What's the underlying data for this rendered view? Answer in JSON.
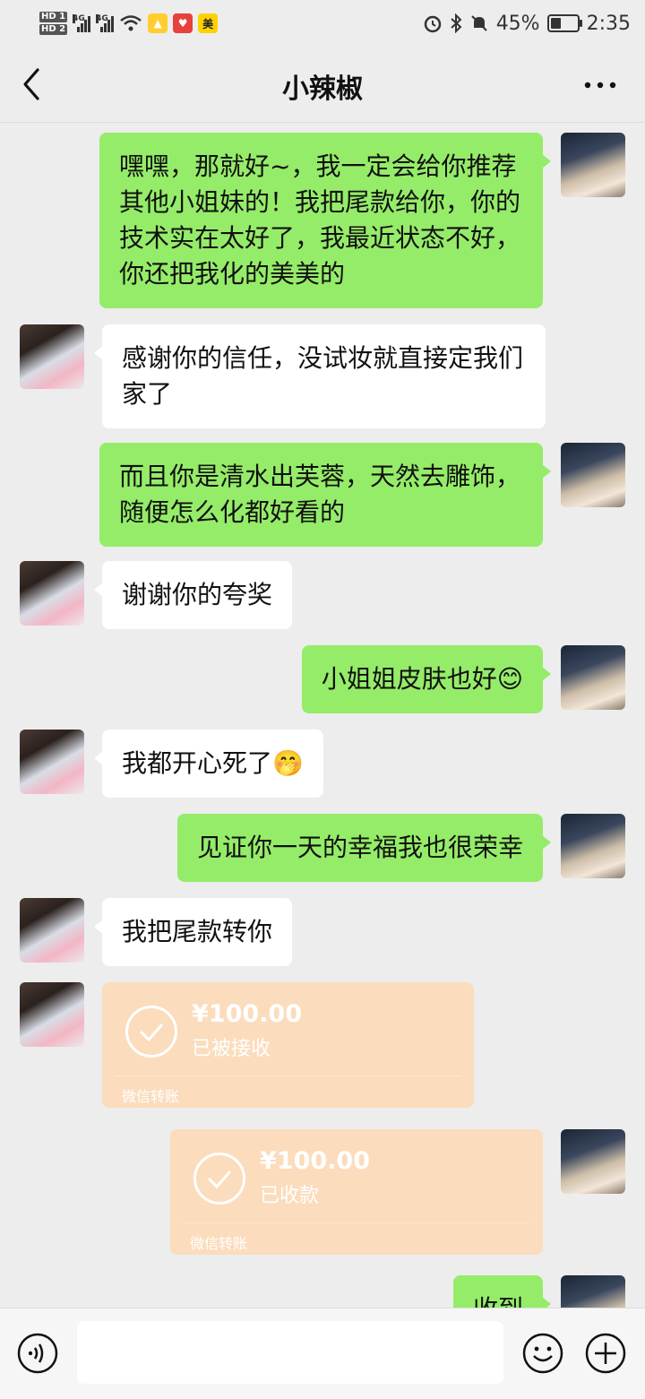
{
  "status_bar": {
    "hd1": "HD 1",
    "hd2": "HD 2",
    "net1": "4G",
    "net2": "4G",
    "app3_label": "美",
    "battery_percent": "45%",
    "battery_level": 0.45,
    "time": "2:35"
  },
  "header": {
    "title": "小辣椒"
  },
  "messages": [
    {
      "from": "me",
      "text": "嘿嘿，那就好~，我一定会给你推荐其他小姐妹的！我把尾款给你，你的技术实在太好了，我最近状态不好，你还把我化的美美的"
    },
    {
      "from": "her",
      "text": "感谢你的信任，没试妆就直接定我们家了"
    },
    {
      "from": "me",
      "text": "而且你是清水出芙蓉，天然去雕饰，随便怎么化都好看的"
    },
    {
      "from": "her",
      "text": "谢谢你的夸奖"
    },
    {
      "from": "me",
      "text": "小姐姐皮肤也好😊"
    },
    {
      "from": "her",
      "text": "我都开心死了🤭"
    },
    {
      "from": "me",
      "text": "见证你一天的幸福我也很荣幸"
    },
    {
      "from": "her",
      "text": "我把尾款转你"
    },
    {
      "from": "me",
      "text": "收到"
    }
  ],
  "transfers": [
    {
      "from": "her",
      "amount": "¥100.00",
      "status": "已被接收",
      "footer": "微信转账"
    },
    {
      "from": "me",
      "amount": "¥100.00",
      "status": "已收款",
      "footer": "微信转账"
    }
  ]
}
